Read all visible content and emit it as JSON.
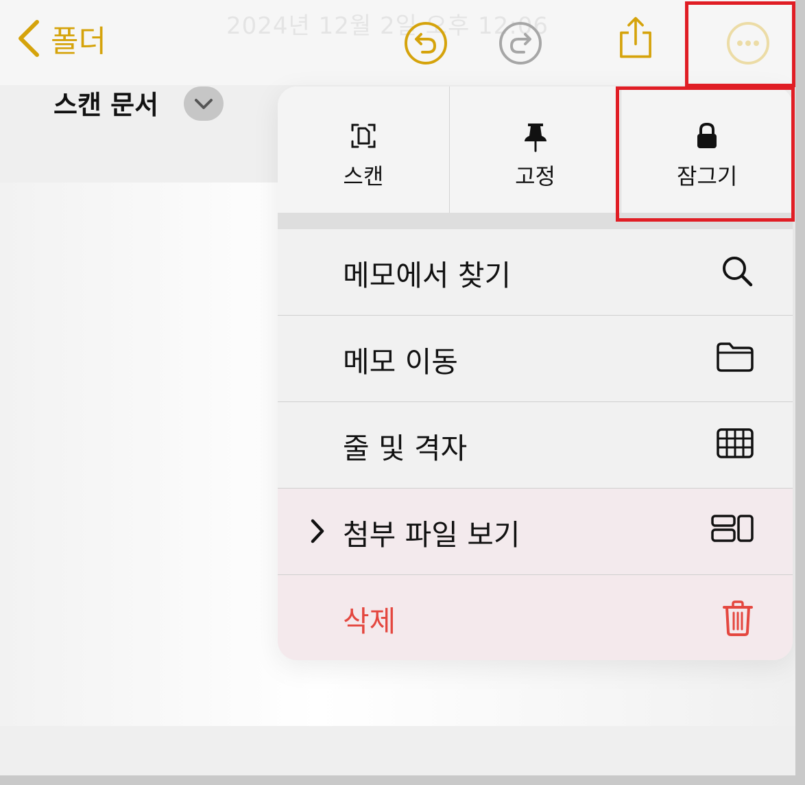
{
  "toolbar": {
    "back_label": "폴더",
    "date_text": "2024년 12월 2일 오후 12:06",
    "icons": [
      "chevron-left-icon",
      "undo-icon",
      "redo-icon",
      "share-icon",
      "more-icon"
    ]
  },
  "note": {
    "title": "스캔 문서"
  },
  "menu": {
    "quick_actions": [
      {
        "label": "스캔",
        "icon": "scan-document-icon"
      },
      {
        "label": "고정",
        "icon": "pin-icon"
      },
      {
        "label": "잠그기",
        "icon": "lock-icon"
      }
    ],
    "items": [
      {
        "label": "메모에서 찾기",
        "icon": "magnifier-icon"
      },
      {
        "label": "메모 이동",
        "icon": "folder-icon"
      },
      {
        "label": "줄 및 격자",
        "icon": "grid-icon"
      },
      {
        "label": "첨부 파일 보기",
        "icon": "attachments-icon"
      },
      {
        "label": "삭제",
        "icon": "trash-icon"
      }
    ]
  },
  "colors": {
    "accent": "#d5a30b",
    "destructive": "#e4473f",
    "highlight": "#e01d24"
  }
}
